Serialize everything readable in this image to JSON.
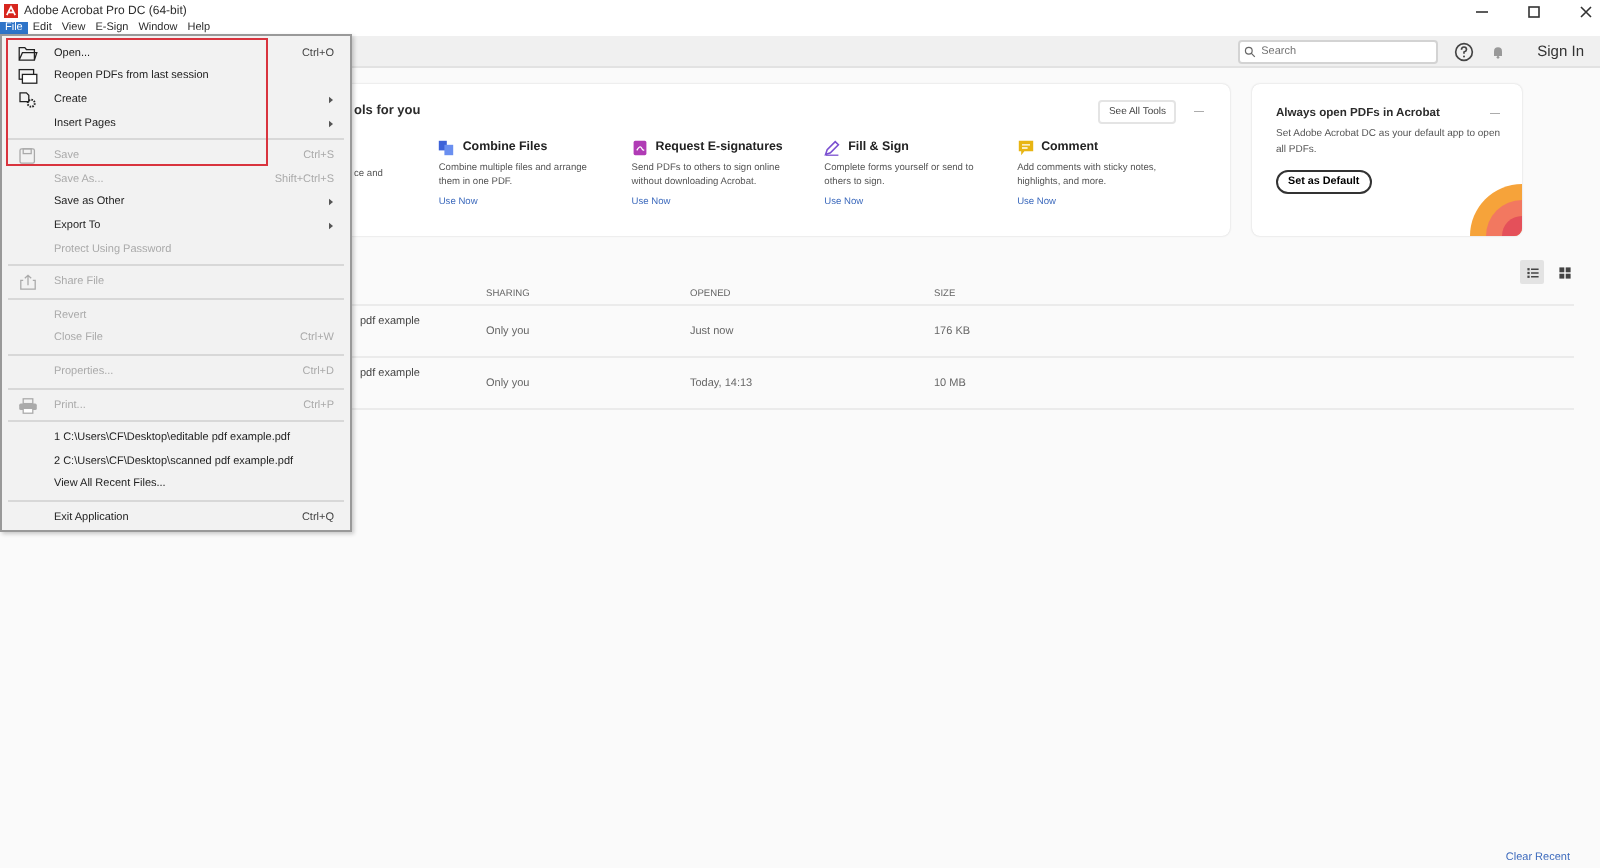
{
  "window": {
    "title": "Adobe Acrobat Pro DC (64-bit)"
  },
  "menu_bar": [
    {
      "label": "File",
      "selected": true
    },
    {
      "label": "Edit",
      "selected": false
    },
    {
      "label": "View",
      "selected": false
    },
    {
      "label": "E-Sign",
      "selected": false
    },
    {
      "label": "Window",
      "selected": false
    },
    {
      "label": "Help",
      "selected": false
    }
  ],
  "toolbar": {
    "search": {
      "placeholder": "Search"
    },
    "sign_in": "Sign In"
  },
  "file_menu": [
    {
      "kind": "open",
      "label": "Open...",
      "shortcut": "Ctrl+O",
      "disabled": false
    },
    {
      "kind": "reopen",
      "label": "Reopen PDFs from last session",
      "disabled": false
    },
    {
      "kind": "create",
      "label": "Create",
      "submenu": true,
      "disabled": false
    },
    {
      "kind": "plain",
      "label": "Insert Pages",
      "submenu": true,
      "disabled": false
    },
    {
      "kind": "separator"
    },
    {
      "kind": "save",
      "label": "Save",
      "shortcut": "Ctrl+S",
      "disabled": true
    },
    {
      "kind": "plain",
      "label": "Save As...",
      "shortcut": "Shift+Ctrl+S",
      "disabled": true
    },
    {
      "kind": "plain",
      "label": "Save as Other",
      "submenu": true,
      "disabled": false
    },
    {
      "kind": "plain",
      "label": "Export To",
      "submenu": true,
      "disabled": false
    },
    {
      "kind": "plain",
      "label": "Protect Using Password",
      "disabled": true
    },
    {
      "kind": "separator"
    },
    {
      "kind": "share",
      "label": "Share File",
      "disabled": true
    },
    {
      "kind": "separator"
    },
    {
      "kind": "plain",
      "label": "Revert",
      "disabled": true
    },
    {
      "kind": "plain",
      "label": "Close File",
      "shortcut": "Ctrl+W",
      "disabled": true
    },
    {
      "kind": "separator"
    },
    {
      "kind": "plain",
      "label": "Properties...",
      "shortcut": "Ctrl+D",
      "disabled": true
    },
    {
      "kind": "separator"
    },
    {
      "kind": "print",
      "label": "Print...",
      "shortcut": "Ctrl+P",
      "disabled": true
    },
    {
      "kind": "separator"
    },
    {
      "kind": "plain",
      "label": "1 C:\\Users\\CF\\Desktop\\editable pdf example.pdf",
      "disabled": false
    },
    {
      "kind": "plain",
      "label": "2 C:\\Users\\CF\\Desktop\\scanned pdf example.pdf",
      "disabled": false
    },
    {
      "kind": "plain",
      "label": "View All Recent Files...",
      "disabled": false
    },
    {
      "kind": "separator"
    },
    {
      "kind": "plain",
      "label": "Exit Application",
      "shortcut": "Ctrl+Q",
      "disabled": false
    }
  ],
  "tools_card": {
    "title": "ols for you",
    "see_all": "See All Tools",
    "close": "—",
    "tools": [
      {
        "kind": "fragment",
        "description": "ce and"
      },
      {
        "kind": "combine",
        "name": "Combine Files",
        "description": "Combine multiple files and arrange them in one PDF.",
        "action": "Use Now"
      },
      {
        "kind": "esign",
        "name": "Request E-signatures",
        "description": "Send PDFs to others to sign online without downloading Acrobat.",
        "action": "Use Now"
      },
      {
        "kind": "fill",
        "name": "Fill & Sign",
        "description": "Complete forms yourself or send to others to sign.",
        "action": "Use Now"
      },
      {
        "kind": "comment",
        "name": "Comment",
        "description": "Add comments with sticky notes, highlights, and more.",
        "action": "Use Now"
      }
    ]
  },
  "default_card": {
    "title": "Always open PDFs in Acrobat",
    "close": "—",
    "text": "Set Adobe Acrobat DC as your default app to open all PDFs.",
    "button": "Set as Default"
  },
  "view_toggles": [
    {
      "kind": "list",
      "selected": true
    },
    {
      "kind": "grid",
      "selected": false
    }
  ],
  "files": {
    "columns": [
      "SHARING",
      "OPENED",
      "SIZE"
    ],
    "rows": [
      {
        "name": "pdf example",
        "sharing": "Only you",
        "opened": "Just now",
        "size": "176 KB"
      },
      {
        "name": "pdf example",
        "sharing": "Only you",
        "opened": "Today, 14:13",
        "size": "10 MB"
      }
    ]
  },
  "footer": {
    "clear_recent": "Clear Recent"
  }
}
